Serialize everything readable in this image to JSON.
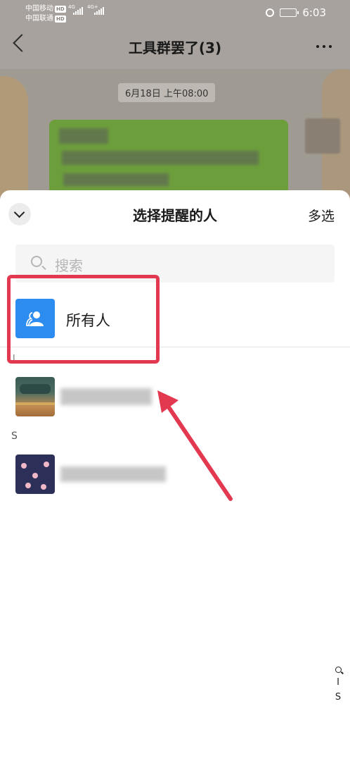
{
  "status_bar": {
    "carrier1": "中国移动",
    "carrier2": "中国联通",
    "hd_badge": "HD",
    "net1": "4G",
    "net2": "4G+",
    "time": "6:03"
  },
  "chat": {
    "title": "工具群罢了(3)",
    "timestamp": "6月18日 上午08:00",
    "bubble_color": "#6d9e3c"
  },
  "sheet": {
    "title": "选择提醒的人",
    "multi_select": "多选",
    "search_placeholder": "搜索",
    "all_label": "所有人",
    "section_i": "I",
    "section_s": "S",
    "index_items": [
      "I",
      "S"
    ]
  },
  "colors": {
    "accent": "#2d8cf0",
    "highlight": "#e23850"
  }
}
